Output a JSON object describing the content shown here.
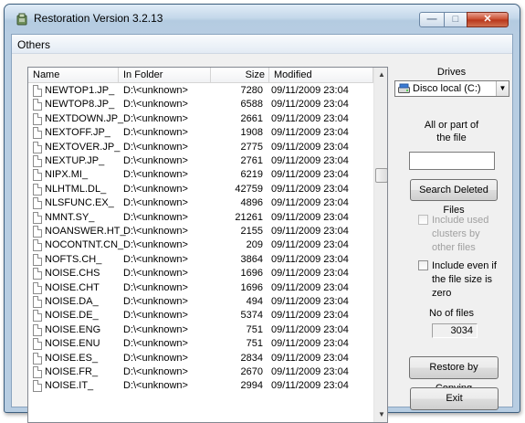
{
  "window": {
    "title": "Restoration Version 3.2.13",
    "controls": {
      "minimize": "—",
      "maximize": "□",
      "close": "✕"
    }
  },
  "menu": {
    "items": [
      {
        "label": "Others"
      }
    ]
  },
  "list": {
    "columns": {
      "name": "Name",
      "folder": "In Folder",
      "size": "Size",
      "modified": "Modified"
    },
    "rows": [
      {
        "name": "NEWTOP1.JP_",
        "folder": "D:\\<unknown>",
        "size": "7280",
        "modified": "09/11/2009 23:04"
      },
      {
        "name": "NEWTOP8.JP_",
        "folder": "D:\\<unknown>",
        "size": "6588",
        "modified": "09/11/2009 23:04"
      },
      {
        "name": "NEXTDOWN.JP_",
        "folder": "D:\\<unknown>",
        "size": "2661",
        "modified": "09/11/2009 23:04"
      },
      {
        "name": "NEXTOFF.JP_",
        "folder": "D:\\<unknown>",
        "size": "1908",
        "modified": "09/11/2009 23:04"
      },
      {
        "name": "NEXTOVER.JP_",
        "folder": "D:\\<unknown>",
        "size": "2775",
        "modified": "09/11/2009 23:04"
      },
      {
        "name": "NEXTUP.JP_",
        "folder": "D:\\<unknown>",
        "size": "2761",
        "modified": "09/11/2009 23:04"
      },
      {
        "name": "NIPX.MI_",
        "folder": "D:\\<unknown>",
        "size": "6219",
        "modified": "09/11/2009 23:04"
      },
      {
        "name": "NLHTML.DL_",
        "folder": "D:\\<unknown>",
        "size": "42759",
        "modified": "09/11/2009 23:04"
      },
      {
        "name": "NLSFUNC.EX_",
        "folder": "D:\\<unknown>",
        "size": "4896",
        "modified": "09/11/2009 23:04"
      },
      {
        "name": "NMNT.SY_",
        "folder": "D:\\<unknown>",
        "size": "21261",
        "modified": "09/11/2009 23:04"
      },
      {
        "name": "NOANSWER.HT_",
        "folder": "D:\\<unknown>",
        "size": "2155",
        "modified": "09/11/2009 23:04"
      },
      {
        "name": "NOCONTNT.CN_",
        "folder": "D:\\<unknown>",
        "size": "209",
        "modified": "09/11/2009 23:04"
      },
      {
        "name": "NOFTS.CH_",
        "folder": "D:\\<unknown>",
        "size": "3864",
        "modified": "09/11/2009 23:04"
      },
      {
        "name": "NOISE.CHS",
        "folder": "D:\\<unknown>",
        "size": "1696",
        "modified": "09/11/2009 23:04"
      },
      {
        "name": "NOISE.CHT",
        "folder": "D:\\<unknown>",
        "size": "1696",
        "modified": "09/11/2009 23:04"
      },
      {
        "name": "NOISE.DA_",
        "folder": "D:\\<unknown>",
        "size": "494",
        "modified": "09/11/2009 23:04"
      },
      {
        "name": "NOISE.DE_",
        "folder": "D:\\<unknown>",
        "size": "5374",
        "modified": "09/11/2009 23:04"
      },
      {
        "name": "NOISE.ENG",
        "folder": "D:\\<unknown>",
        "size": "751",
        "modified": "09/11/2009 23:04"
      },
      {
        "name": "NOISE.ENU",
        "folder": "D:\\<unknown>",
        "size": "751",
        "modified": "09/11/2009 23:04"
      },
      {
        "name": "NOISE.ES_",
        "folder": "D:\\<unknown>",
        "size": "2834",
        "modified": "09/11/2009 23:04"
      },
      {
        "name": "NOISE.FR_",
        "folder": "D:\\<unknown>",
        "size": "2670",
        "modified": "09/11/2009 23:04"
      },
      {
        "name": "NOISE.IT_",
        "folder": "D:\\<unknown>",
        "size": "2994",
        "modified": "09/11/2009 23:04"
      }
    ]
  },
  "side": {
    "drives_label": "Drives",
    "drive_selected": "Disco local (C:)",
    "search_label_line1": "All or part of",
    "search_label_line2": "the file",
    "search_value": "",
    "search_button": "Search Deleted Files",
    "include_used_label": "Include used clusters by other files",
    "include_used_checked": false,
    "include_used_enabled": false,
    "include_even_label": "Include even if the file size is zero",
    "include_even_checked": false,
    "no_of_files_label": "No of files",
    "no_of_files_value": "3034",
    "restore_button": "Restore by Copying",
    "exit_button": "Exit"
  },
  "colors": {
    "window_frame": "#b7cde2",
    "close_button": "#c94a2c",
    "list_border": "#828790"
  }
}
